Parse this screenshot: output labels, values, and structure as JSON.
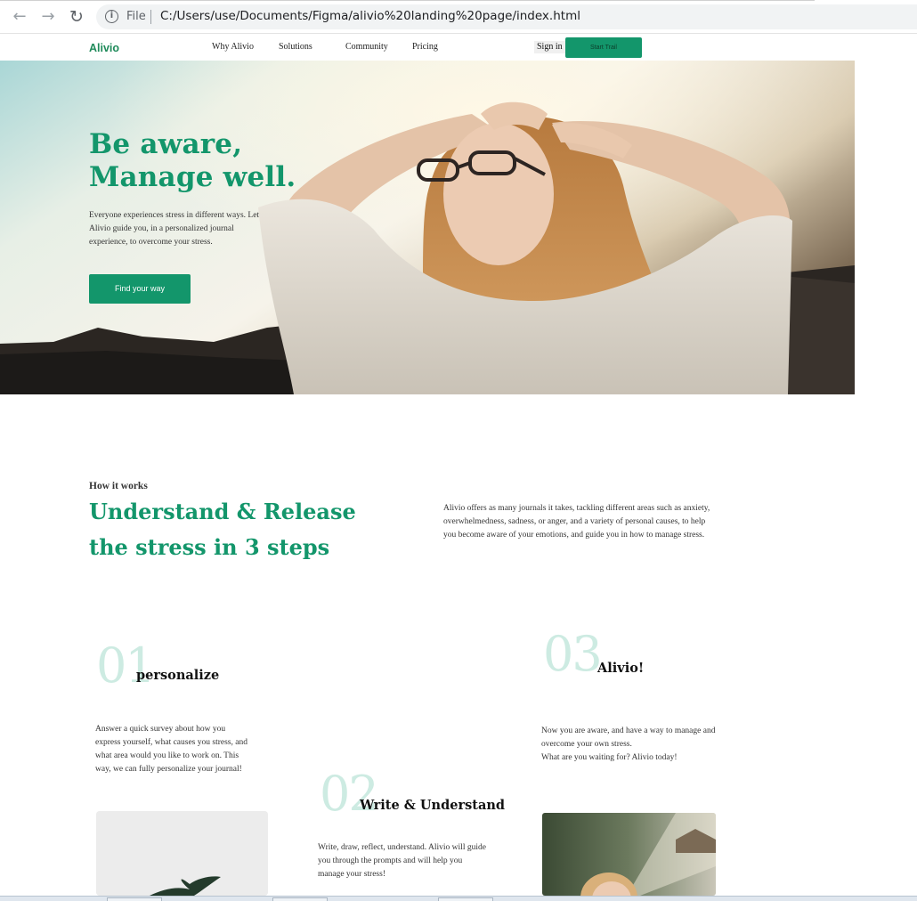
{
  "browser": {
    "scheme": "File",
    "url": "C:/Users/use/Documents/Figma/alivio%20landing%20page/index.html",
    "back_icon": "back-arrow-icon",
    "forward_icon": "forward-arrow-icon",
    "reload_icon": "reload-icon",
    "info_icon": "info-icon"
  },
  "nav": {
    "logo": "Alivio",
    "links": [
      "Why Alivio",
      "Solutions",
      "Community",
      "Pricing"
    ],
    "signin": "Sign in",
    "cta": "Start Trail"
  },
  "hero": {
    "title_line1": "Be aware,",
    "title_line2": "Manage well.",
    "description": "Everyone experiences stress in different ways. Let Alivio guide you, in a personalized journal experience, to overcome your stress.",
    "cta": "Find your way"
  },
  "how_it_works": {
    "label": "How it works",
    "title_line1": "Understand & Release",
    "title_line2": "the stress in 3 steps",
    "description": "Alivio offers as many journals it takes, tackling different areas such as anxiety, overwhelmedness, sadness, or anger, and a variety of personal causes, to help you become aware of your emotions, and guide you in how to manage stress."
  },
  "steps": [
    {
      "number": "01",
      "title": "personalize",
      "description": "Answer a quick survey about how you express yourself, what causes you stress, and what area would you like to work on. This way, we can fully personalize your journal!"
    },
    {
      "number": "02",
      "title": "Write & Understand",
      "description": "Write, draw, reflect, understand. Alivio will guide you through the prompts and will help you manage your stress!"
    },
    {
      "number": "03",
      "title": "Alivio!",
      "description_line1": "Now you are aware, and have a way to manage and overcome your own stress.",
      "description_line2": "What are you waiting for? Alivio today!"
    }
  ],
  "colors": {
    "brand_green": "#13966b",
    "step_number": "#cdebe2"
  }
}
